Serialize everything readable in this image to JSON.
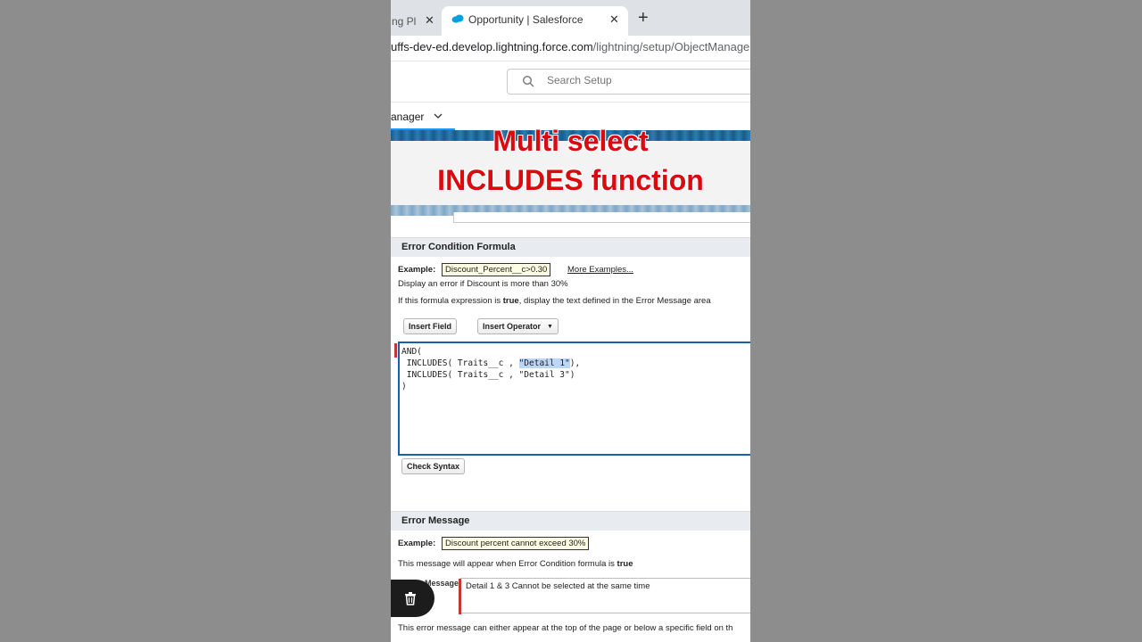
{
  "browser": {
    "inactive_tab_title": "ng Pl",
    "active_tab_title": "Opportunity | Salesforce",
    "new_tab_symbol": "+",
    "close_symbol": "✕",
    "url_host": "uffs-dev-ed.develop.lightning.force.com",
    "url_path": "/lightning/setup/ObjectManage"
  },
  "header": {
    "search_placeholder": "Search Setup"
  },
  "nav": {
    "tab_label": "anager"
  },
  "overlay": {
    "line1": "Multi select",
    "line2": "INCLUDES function"
  },
  "error_condition": {
    "heading": "Error Condition Formula",
    "example_label": "Example:",
    "example_value": "Discount_Percent__c>0.30",
    "more_examples": "More Examples...",
    "description": "Display an error if Discount is more than 30%",
    "true_prefix": "If this formula expression is ",
    "true_word": "true",
    "true_suffix": ", display the text defined in the Error Message area",
    "insert_field": "Insert Field",
    "insert_operator": "Insert Operator",
    "formula_line1": "AND(",
    "formula_line2_a": " INCLUDES( Traits__c , ",
    "formula_line2_sel": "\"Detail 1\"",
    "formula_line2_b": "),",
    "formula_line3": " INCLUDES( Traits__c , \"Detail 3\")",
    "formula_line4": ")",
    "check_syntax": "Check Syntax"
  },
  "error_message": {
    "heading": "Error Message",
    "example_label": "Example:",
    "example_value": "Discount percent cannot exceed 30%",
    "appear_prefix": "This message will appear when Error Condition formula is ",
    "appear_word": "true",
    "field_label": "Message",
    "value": "Detail 1 & 3 Cannot be selected at the same time",
    "location_text": "This error message can either appear at the top of the page or below a specific field on th"
  },
  "colors": {
    "overlay_red": "#d80c10",
    "editor_border": "#1b5fa8",
    "required_bar": "#c23934"
  }
}
